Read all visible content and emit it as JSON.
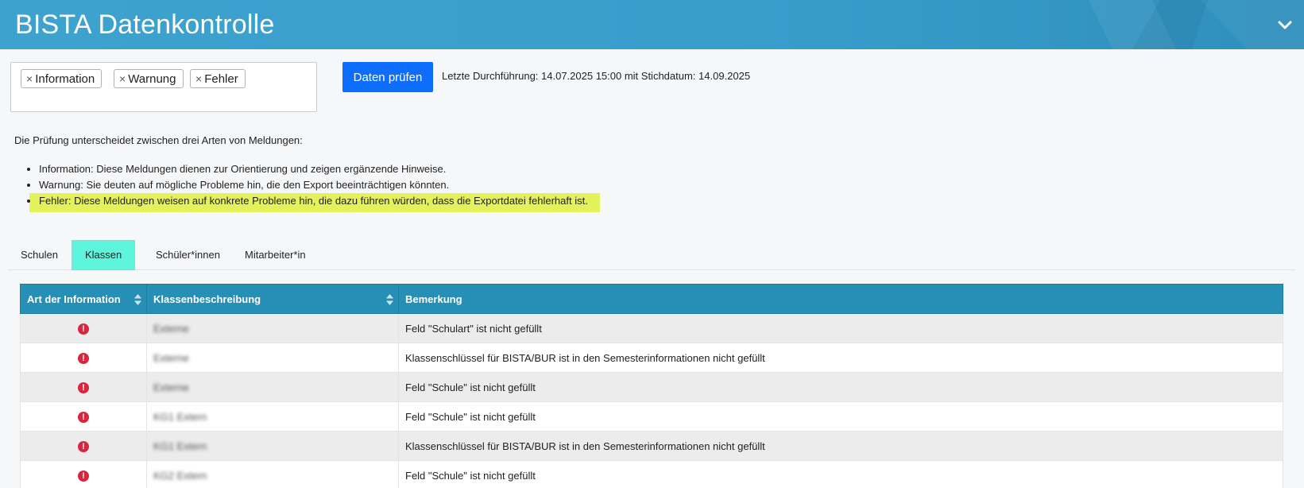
{
  "app": {
    "title": "BISTA Datenkontrolle"
  },
  "filters": {
    "tags": [
      "Information",
      "Warnung",
      "Fehler"
    ],
    "remove_glyph": "×"
  },
  "actions": {
    "check_label": "Daten prüfen",
    "last_run": "Letzte Durchführung: 14.07.2025 15:00 mit Stichdatum: 14.09.2025"
  },
  "intro": {
    "text": "Die Prüfung unterscheidet zwischen drei Arten von Meldungen:",
    "items": [
      "Information: Diese Meldungen dienen zur Orientierung und zeigen ergänzende Hinweise.",
      "Warnung: Sie deuten auf mögliche Probleme hin, die den Export beeinträchtigen könnten.",
      "Fehler: Diese Meldungen weisen auf konkrete Probleme hin, die dazu führen würden, dass die Exportdatei fehlerhaft ist."
    ],
    "highlight_color": "#e3f25a"
  },
  "tabs": [
    {
      "label": "Schulen",
      "active": false
    },
    {
      "label": "Klassen",
      "active": true
    },
    {
      "label": "Schüler*innen",
      "active": false
    },
    {
      "label": "Mitarbeiter*in",
      "active": false
    }
  ],
  "table": {
    "columns": [
      "Art der Information",
      "Klassenbeschreibung",
      "Bemerkung"
    ],
    "rows": [
      {
        "type": "error-icon",
        "class": "Externe",
        "remark": "Feld \"Schulart\" ist nicht gefüllt"
      },
      {
        "type": "error-icon",
        "class": "Externe",
        "remark": "Klassenschlüssel für BISTA/BUR ist in den Semesterinformationen nicht gefüllt"
      },
      {
        "type": "error-icon",
        "class": "Externe",
        "remark": "Feld \"Schule\" ist nicht gefüllt"
      },
      {
        "type": "error-icon",
        "class": "KG1 Extern",
        "remark": "Feld \"Schule\" ist nicht gefüllt"
      },
      {
        "type": "error-icon",
        "class": "KG1 Extern",
        "remark": "Klassenschlüssel für BISTA/BUR ist in den Semesterinformationen nicht gefüllt"
      },
      {
        "type": "error-icon",
        "class": "KG2 Extern",
        "remark": "Feld \"Schule\" ist nicht gefüllt"
      }
    ]
  },
  "colors": {
    "header": "#3ea2cf",
    "primary_button": "#0d6efd",
    "table_header": "#258fb5",
    "active_tab": "#5ef5dd",
    "error": "#d7263d"
  }
}
